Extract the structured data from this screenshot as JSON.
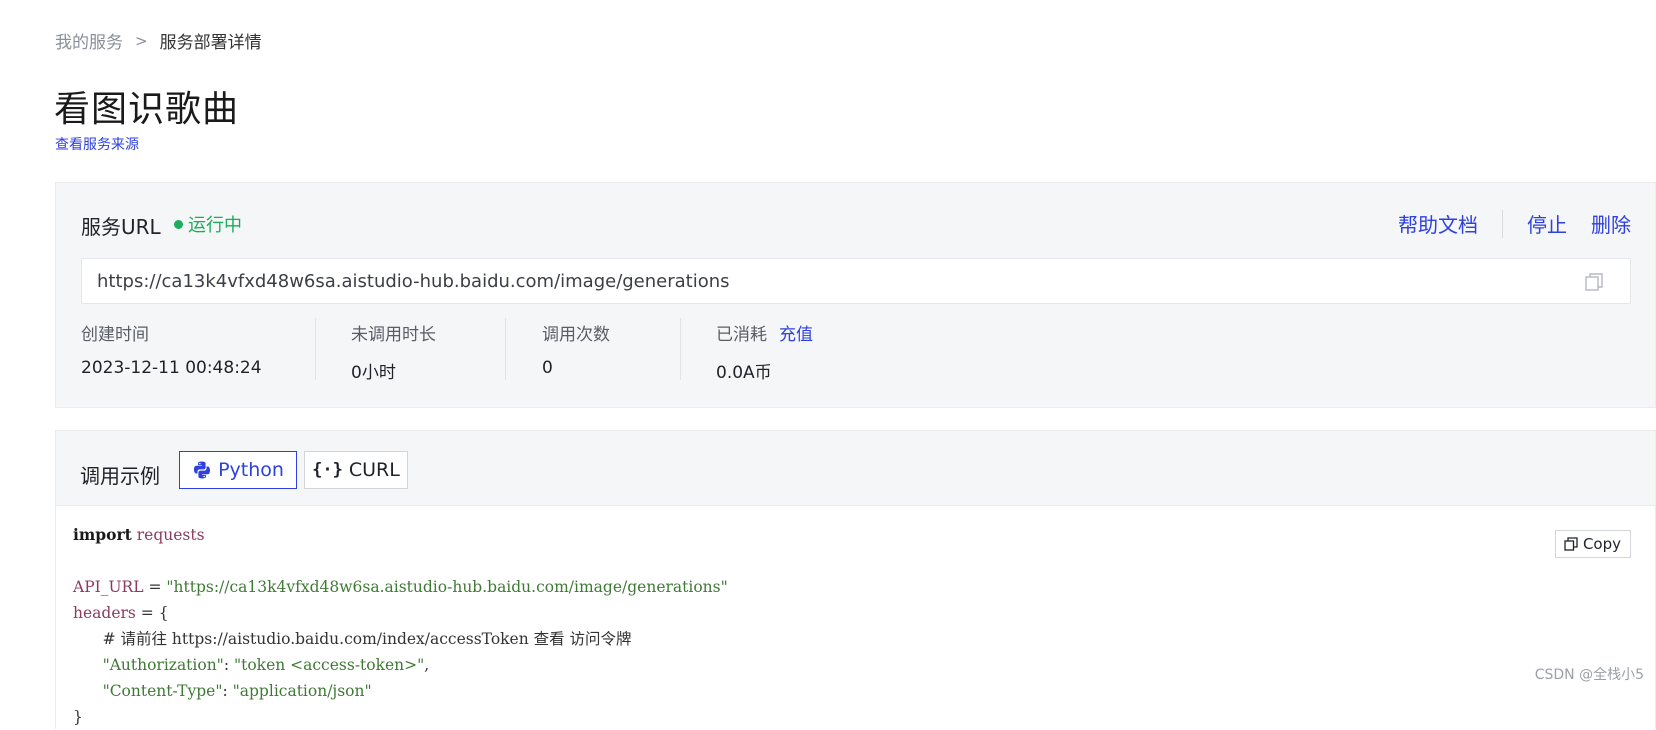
{
  "breadcrumb": {
    "root": "我的服务",
    "separator": ">",
    "current": "服务部署详情"
  },
  "page": {
    "title": "看图识歌曲",
    "source_link": "查看服务来源"
  },
  "service": {
    "label": "服务URL",
    "status": "运行中",
    "actions": {
      "help": "帮助文档",
      "stop": "停止",
      "delete": "删除"
    },
    "url": "https://ca13k4vfxd48w6sa.aistudio-hub.baidu.com/image/generations",
    "stats": [
      {
        "label": "创建时间",
        "value": "2023-12-11 00:48:24"
      },
      {
        "label": "未调用时长",
        "value": "0小时"
      },
      {
        "label": "调用次数",
        "value": "0"
      },
      {
        "label": "已消耗",
        "value": "0.0A币",
        "extra": "充值"
      }
    ]
  },
  "example": {
    "label": "调用示例",
    "tabs": [
      {
        "label": "Python",
        "active": true
      },
      {
        "label": "CURL",
        "active": false
      }
    ],
    "copy_label": "Copy",
    "code": {
      "import_kw": "import",
      "import_mod": "requests",
      "api_var": "API_URL",
      "eq": " = ",
      "api_str": "\"https://ca13k4vfxd48w6sa.aistudio-hub.baidu.com/image/generations\"",
      "headers_var": "headers",
      "headers_open": " = {",
      "comment": "# 请前往 https://aistudio.baidu.com/index/accessToken 查看 访问令牌",
      "auth_key": "\"Authorization\"",
      "auth_val": "\"token <access-token>\"",
      "ct_key": "\"Content-Type\"",
      "ct_val": "\"application/json\"",
      "close": "}"
    }
  },
  "watermark": "CSDN @全栈小5",
  "colors": {
    "accent": "#2e40dd",
    "status": "#1aae5a",
    "panel": "#f5f6f8"
  }
}
